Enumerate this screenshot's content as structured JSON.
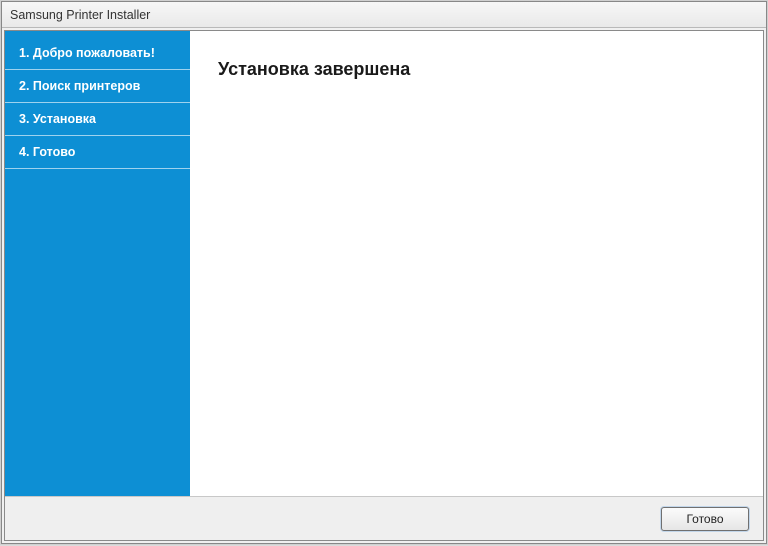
{
  "window": {
    "title": "Samsung Printer Installer"
  },
  "sidebar": {
    "items": [
      {
        "label": "1. Добро пожаловать!"
      },
      {
        "label": "2. Поиск принтеров"
      },
      {
        "label": "3. Установка"
      },
      {
        "label": "4. Готово"
      }
    ]
  },
  "main": {
    "heading": "Установка завершена"
  },
  "footer": {
    "done_label": "Готово"
  }
}
